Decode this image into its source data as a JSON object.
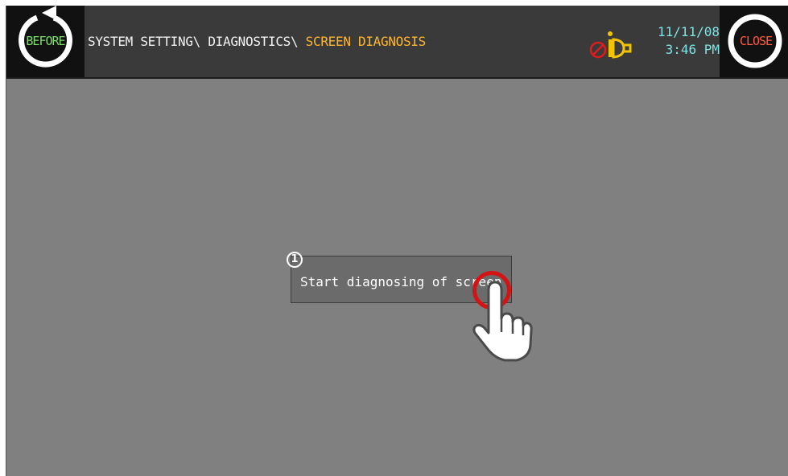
{
  "header": {
    "before_label": "BEFORE",
    "close_label": "CLOSE",
    "breadcrumb_path": "SYSTEM SETTING\\ DIAGNOSTICS\\ ",
    "breadcrumb_current": "SCREEN DIAGNOSIS",
    "date": "11/11/08",
    "time": "3:46 PM"
  },
  "main": {
    "step_number": "1",
    "diag_button_label": "Start diagnosing of screen"
  },
  "icons": {
    "before": "back-arrow-icon",
    "close": "close-icon",
    "alarm": "alarm-muted-bell-icon",
    "touch": "pointing-hand-icon"
  },
  "colors": {
    "screen_background": "#808080",
    "header_background": "#3a3a3a",
    "before_accent": "#7fdc6a",
    "close_accent": "#ff5a3c",
    "breadcrumb_current": "#ffb62e",
    "clock_text": "#7ee3e3",
    "alarm_bell": "#f2c300",
    "touch_ring": "#d41414"
  }
}
